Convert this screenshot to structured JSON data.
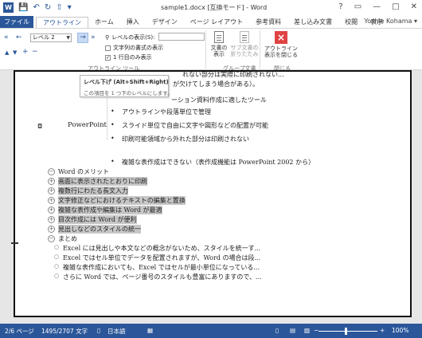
{
  "titlebar": {
    "logo": "W",
    "qat": [
      "💾",
      "↶",
      "↻",
      "⇧",
      "▾"
    ],
    "title": "sample1.docx [互換モード] - Word",
    "controls": [
      "?",
      "▭",
      "—",
      "□",
      "✕"
    ]
  },
  "tabs": [
    "ファイル",
    "アウトライン",
    "ホーム",
    "挿入",
    "デザイン",
    "ページ レイアウト",
    "参考資料",
    "差し込み文書",
    "校閲",
    "表示"
  ],
  "active_tab": "アウトライン",
  "user": "Yoshie Kohama ▾",
  "ribbon": {
    "outline_tools": {
      "promote_top": "«",
      "promote": "←",
      "level_value": "レベル 2",
      "demote": "→",
      "demote_body": "»",
      "move_up": "▲",
      "move_down": "▼",
      "expand": "+",
      "collapse": "−",
      "show_level_label": "レベルの表示(S):",
      "show_text_format": "文字列の書式の表示",
      "show_first_line": "1 行目のみ表示",
      "group_label": "アウトライン ツール"
    },
    "master_doc": {
      "show_doc_top": "文書の",
      "show_doc_bottom": "表示",
      "collapse_top": "サブ文書の",
      "collapse_bottom": "折りたたみ",
      "group_label": "グループ文書"
    },
    "close": {
      "label_top": "アウトライン",
      "label_bottom": "表示を閉じる",
      "group_label": "閉じる"
    }
  },
  "tooltip": {
    "title": "レベル下げ (Alt+Shift+Right)",
    "desc": "この項目を 1 つ下のレベルにします。"
  },
  "document": {
    "partial_top_right": "れない部分は実際に印刷されない...",
    "partial_second": "が欠けてしまう場合がある）。",
    "partial_third": "ーション資料作成に適したツール",
    "table_label": "PowerPoint",
    "table_bullets": [
      "アウトラインや段落単位で管理",
      "スライド単位で自由に文字や図形などの配置が可能",
      "印刷可能領域から外れた部分は印刷されない",
      "複雑な表作成はできない（表作成機能は PowerPoint 2002 から）"
    ],
    "outline_items": [
      {
        "sym": "−",
        "text": "Word のメリット",
        "hl": false
      },
      {
        "sym": "+",
        "text": "画面に表示されたとおりに印刷",
        "hl": true
      },
      {
        "sym": "+",
        "text": "複数行にわたる長文入力",
        "hl": true
      },
      {
        "sym": "+",
        "text": "文字修正などにおけるテキストの編集と置換",
        "hl": true
      },
      {
        "sym": "+",
        "text": "複雑な表作成や編集は Word が最適",
        "hl": true
      },
      {
        "sym": "+",
        "text": "目次作成には Word が便利",
        "hl": true
      },
      {
        "sym": "+",
        "text": "見出しなどのスタイルの統一",
        "hl": true
      },
      {
        "sym": "−",
        "text": "まとめ",
        "hl": false
      }
    ],
    "sub_items": [
      "Excel には見出しや本文などの概念がないため、スタイルを統一す...",
      "Excel ではセル単位でデータを配置されますが、Word の場合は段...",
      "複雑な表作成においても、Excel ではセルが最小単位になっている...",
      "さらに Word では、ページ番号のスタイルも豊富にありますので、..."
    ]
  },
  "status": {
    "page": "2/6 ページ",
    "words": "1495/2707 文字",
    "proof_icon": "▯",
    "lang": "日本語",
    "macro_icon": "▦",
    "view_read": "▯",
    "view_print": "▤",
    "view_web": "▧",
    "zoom_minus": "−",
    "zoom_plus": "+",
    "zoom": "100%",
    "zoom_level": 0.45
  }
}
